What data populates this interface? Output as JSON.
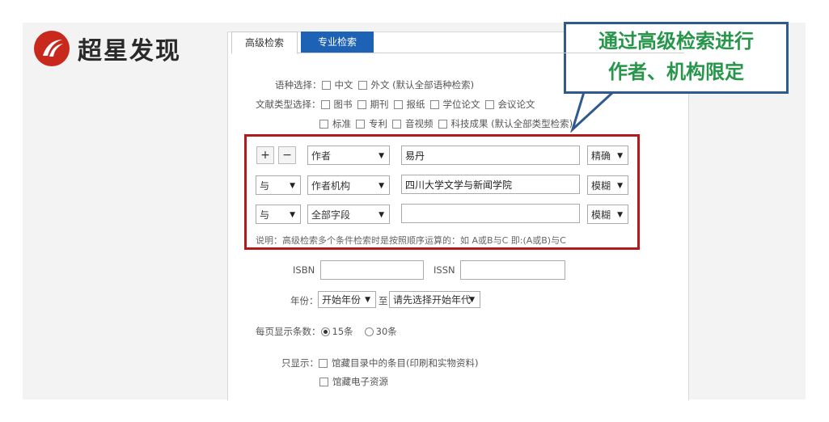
{
  "brand": {
    "name": "超星发现"
  },
  "tabs": [
    {
      "label": "高级检索"
    },
    {
      "label": "专业检索"
    }
  ],
  "language": {
    "label": "语种选择：",
    "options": [
      "中文",
      "外文 (默认全部语种检索)"
    ]
  },
  "doctype": {
    "label": "文献类型选择：",
    "row1": [
      "图书",
      "期刊",
      "报纸",
      "学位论文",
      "会议论文"
    ],
    "row2": [
      "标准",
      "专利",
      "音视频",
      "科技成果 (默认全部类型检索)"
    ]
  },
  "conditions": {
    "add_label": "+",
    "remove_label": "−",
    "rows": [
      {
        "logic": "",
        "field": "作者",
        "value": "易丹",
        "match": "精确"
      },
      {
        "logic": "与",
        "field": "作者机构",
        "value": "四川大学文学与新闻学院",
        "match": "模糊"
      },
      {
        "logic": "与",
        "field": "全部字段",
        "value": "",
        "match": "模糊"
      }
    ],
    "note": "说明：高级检索多个条件检索时是按照顺序运算的：如 A或B与C 即:(A或B)与C"
  },
  "isbn": {
    "label": "ISBN",
    "value": ""
  },
  "issn": {
    "label": "ISSN",
    "value": ""
  },
  "year": {
    "label": "年份：",
    "start": "开始年份",
    "to": "至",
    "end": "请先选择开始年代"
  },
  "per_page": {
    "label": "每页显示条数：",
    "options": [
      "15条",
      "30条"
    ],
    "selected": "15条"
  },
  "show_only": {
    "label": "只显示：",
    "options": [
      "馆藏目录中的条目(印刷和实物资料)",
      "馆藏电子资源"
    ]
  },
  "callout": {
    "line1": "通过高级检索进行",
    "line2": "作者、机构限定"
  },
  "colors": {
    "accent": "#1d62b5",
    "highlight_border": "#b01c1c",
    "callout_text": "#27964b",
    "callout_border": "#2e5a8f"
  }
}
